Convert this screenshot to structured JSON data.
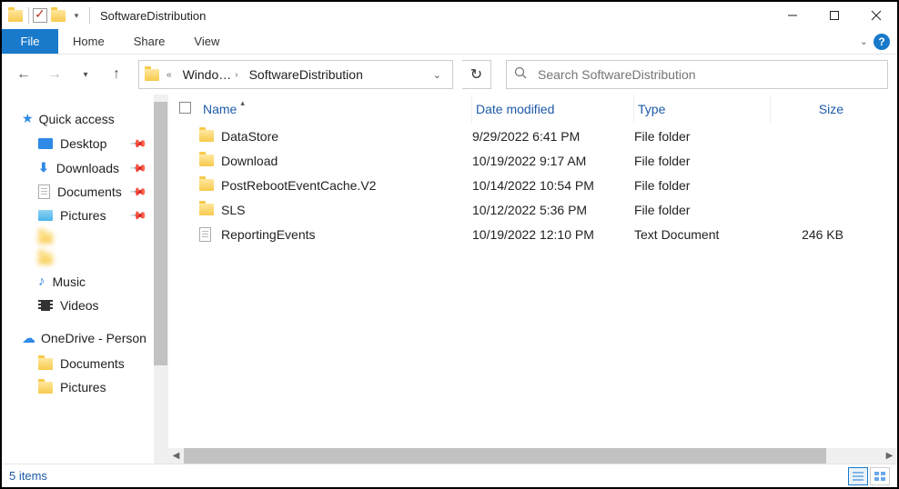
{
  "window": {
    "title": "SoftwareDistribution"
  },
  "ribbon": {
    "file": "File",
    "tabs": [
      "Home",
      "Share",
      "View"
    ]
  },
  "breadcrumb": {
    "segments": [
      "Windo…",
      "SoftwareDistribution"
    ]
  },
  "search": {
    "placeholder": "Search SoftwareDistribution"
  },
  "sidebar": {
    "quick_access": "Quick access",
    "items": [
      {
        "label": "Desktop",
        "icon": "monitor",
        "pinned": true
      },
      {
        "label": "Downloads",
        "icon": "down",
        "pinned": true
      },
      {
        "label": "Documents",
        "icon": "doc",
        "pinned": true
      },
      {
        "label": "Pictures",
        "icon": "pic",
        "pinned": true
      },
      {
        "label": " ",
        "icon": "folder",
        "pinned": false,
        "blur": true
      },
      {
        "label": " ",
        "icon": "folder",
        "pinned": false,
        "blur": true
      },
      {
        "label": "Music",
        "icon": "music",
        "pinned": false
      },
      {
        "label": "Videos",
        "icon": "video",
        "pinned": false
      }
    ],
    "onedrive": "OneDrive - Person",
    "onedrive_children": [
      "Documents",
      "Pictures"
    ]
  },
  "columns": {
    "name": "Name",
    "date": "Date modified",
    "type": "Type",
    "size": "Size"
  },
  "files": [
    {
      "name": "DataStore",
      "date": "9/29/2022 6:41 PM",
      "type": "File folder",
      "size": "",
      "icon": "folder"
    },
    {
      "name": "Download",
      "date": "10/19/2022 9:17 AM",
      "type": "File folder",
      "size": "",
      "icon": "folder"
    },
    {
      "name": "PostRebootEventCache.V2",
      "date": "10/14/2022 10:54 PM",
      "type": "File folder",
      "size": "",
      "icon": "folder"
    },
    {
      "name": "SLS",
      "date": "10/12/2022 5:36 PM",
      "type": "File folder",
      "size": "",
      "icon": "folder"
    },
    {
      "name": "ReportingEvents",
      "date": "10/19/2022 12:10 PM",
      "type": "Text Document",
      "size": "246 KB",
      "icon": "doc"
    }
  ],
  "status": {
    "text": "5 items"
  }
}
